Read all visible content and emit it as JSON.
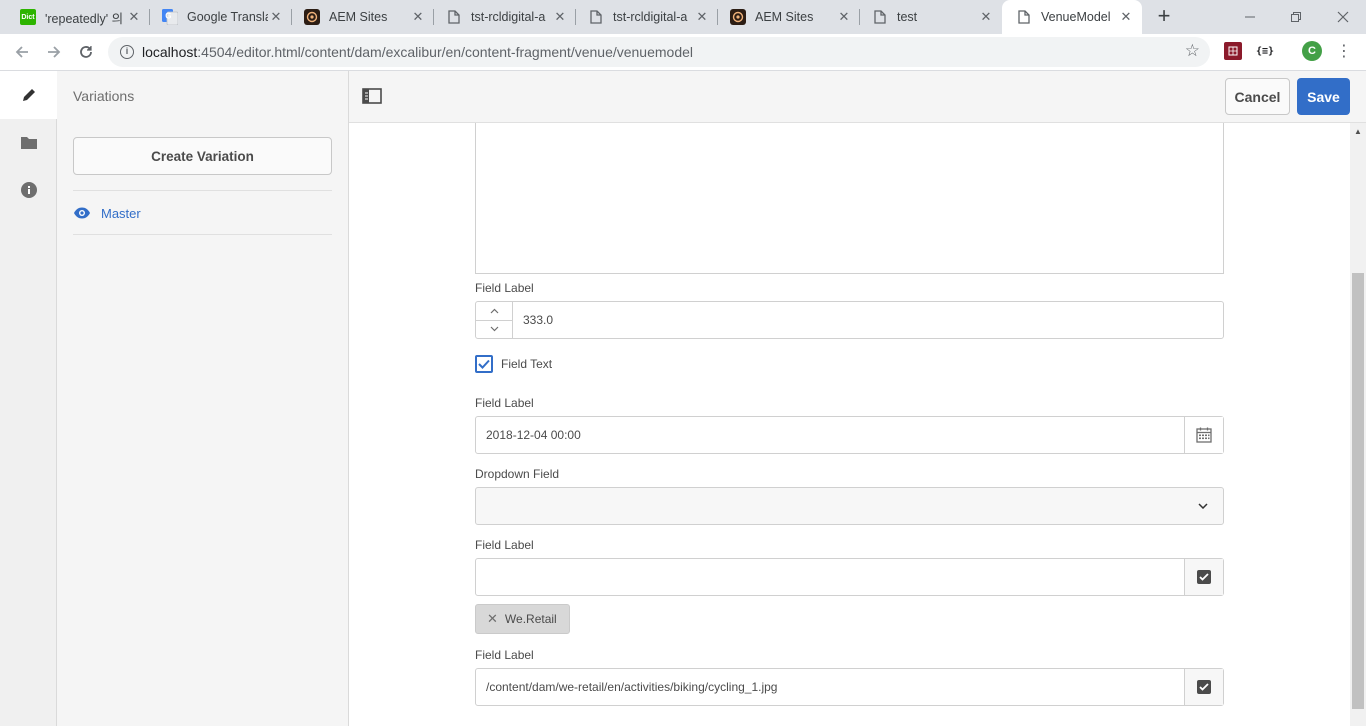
{
  "browser": {
    "tabs": [
      {
        "title": "'repeatedly' 의",
        "favicon": "dict-icon",
        "active": false
      },
      {
        "title": "Google Transla",
        "favicon": "google-translate-icon",
        "active": false
      },
      {
        "title": "AEM Sites",
        "favicon": "aem-icon",
        "active": false
      },
      {
        "title": "tst-rcldigital-a",
        "favicon": "page-icon",
        "active": false
      },
      {
        "title": "tst-rcldigital-a",
        "favicon": "page-icon",
        "active": false
      },
      {
        "title": "AEM Sites",
        "favicon": "aem-icon",
        "active": false
      },
      {
        "title": "test",
        "favicon": "page-icon",
        "active": false
      },
      {
        "title": "VenueModel",
        "favicon": "page-icon",
        "active": true
      }
    ],
    "url_host": "localhost",
    "url_rest": ":4504/editor.html/content/dam/excalibur/en/content-fragment/venue/venuemodel",
    "profile_initial": "C",
    "favicon_dict_text": "Dict",
    "ext_json_text": "{≡}",
    "colors": {
      "accent": "#326ec8",
      "profile": "#43a047"
    }
  },
  "sidebar": {
    "title": "Variations",
    "create_button": "Create Variation",
    "variations": [
      {
        "label": "Master"
      }
    ]
  },
  "header": {
    "cancel": "Cancel",
    "save": "Save"
  },
  "form": {
    "number_field": {
      "label": "Field Label",
      "value": "333.0"
    },
    "checkbox_field": {
      "label": "Field Text",
      "checked": true
    },
    "date_field": {
      "label": "Field Label",
      "value": "2018-12-04 00:00"
    },
    "dropdown_field": {
      "label": "Dropdown Field",
      "value": ""
    },
    "tags_field": {
      "label": "Field Label",
      "value": "",
      "tags": [
        "We.Retail"
      ]
    },
    "path_field": {
      "label": "Field Label",
      "value": "/content/dam/we-retail/en/activities/biking/cycling_1.jpg"
    }
  }
}
